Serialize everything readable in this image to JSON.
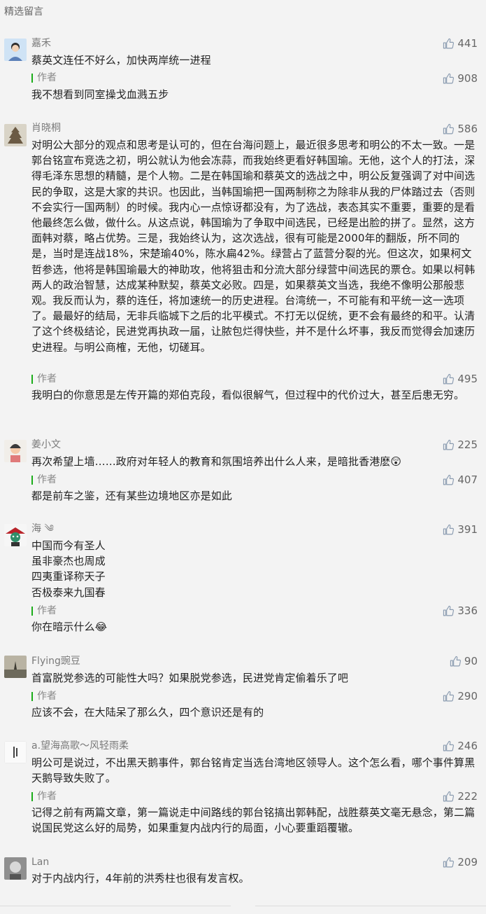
{
  "header": {
    "title": "精选留言"
  },
  "author_label": "作者",
  "comments": [
    {
      "nick": "嘉禾",
      "likes": "441",
      "text": "蔡英文连任不好么，加快两岸统一进程",
      "reply": "我不想看到同室操戈血溅五步",
      "reply_likes": "908"
    },
    {
      "nick": "肖晓桐",
      "likes": "586",
      "text": "对明公大部分的观点和思考是认可的，但在台海问题上，最近很多思考和明公的不太一致。一是郭台铭宣布竞选之初，明公就认为他会冻蒜，而我始终更看好韩国瑜。无他，这个人的打法，深得毛泽东思想的精髓，是个人物。二是在韩国瑜和蔡英文的选战之中，明公反复强调了对中间选民的争取，这是大家的共识。也因此，当韩国瑜把一国两制称之为除非从我的尸体踏过去（否则不会实行一国两制）的时候。我内心一点惊讶都没有，为了选战，表态其实不重要，重要的是看他最终怎么做，做什么。从这点说，韩国瑜为了争取中间选民，已经是出脸的拼了。显然，这方面韩对蔡，略占优势。三是，我始终认为，这次选战，很有可能是2000年的翻版，所不同的是，当时是连战18%，宋楚瑜40%，陈水扁42%。绿营占了蓝营分裂的光。但这次，如果柯文哲参选，他将是韩国瑜最大的神助攻，他将狙击和分流大部分绿营中间选民的票仓。如果以柯韩两人的政治智慧，达成某种默契，蔡英文必败。四是，如果蔡英文当选，我绝不像明公那般悲观。我反而认为，蔡的连任，将加速统一的历史进程。台湾统一，不可能有和平统一这一选项了。最最好的结局，无非兵临城下之后的北平模式。不打无以促统，更不会有最终的和平。认清了这个终极结论，民进党再执政一届，让脓包烂得快些，并不是什么坏事，我反而觉得会加速历史进程。与明公商榷，无他，切磋耳。",
      "reply": "我明白的你意思是左传开篇的郑伯克段，看似很解气，但过程中的代价过大，甚至后患无穷。",
      "reply_likes": "495"
    },
    {
      "nick": "姜小文",
      "likes": "225",
      "text": "再次希望上墙……政府对年轻人的教育和氛围培养出什么人来，是暗批香港麽😲",
      "reply": "都是前车之鉴，还有某些边境地区亦是如此",
      "reply_likes": "407"
    },
    {
      "nick": "海 ༄",
      "likes": "391",
      "text": "中国而今有圣人\n虽非豪杰也周成\n四夷重译称天子\n否极泰来九国春",
      "reply": "你在暗示什么😂",
      "reply_likes": "336"
    },
    {
      "nick": "Flying豌豆",
      "likes": "90",
      "text": "首富脱党参选的可能性大吗？如果脱党参选，民进党肯定偷着乐了吧",
      "reply": "应该不会，在大陆呆了那么久，四个意识还是有的",
      "reply_likes": "290"
    },
    {
      "nick": "a.望海高歌～风轻雨柔",
      "likes": "246",
      "text": "明公可是说过，不出黑天鹅事件，郭台铭肯定当选台湾地区领导人。这个怎么看，哪个事件算黑天鹅导致失败了。",
      "reply": "记得之前有两篇文章，第一篇说走中间路线的郭台铭搞出郭韩配，战胜蔡英文毫无悬念，第二篇说国民党这么好的局势，如果重复内战内行的局面，小心要重蹈覆辙。",
      "reply_likes": "222"
    },
    {
      "nick": "Lan",
      "likes": "209",
      "text": "对于内战内行，4年前的洪秀柱也很有发言权。"
    }
  ],
  "colors": {
    "author_accent": "#1aad19",
    "text": "#222222",
    "meta": "#7a7a7a",
    "background": "#f3f3f3"
  }
}
